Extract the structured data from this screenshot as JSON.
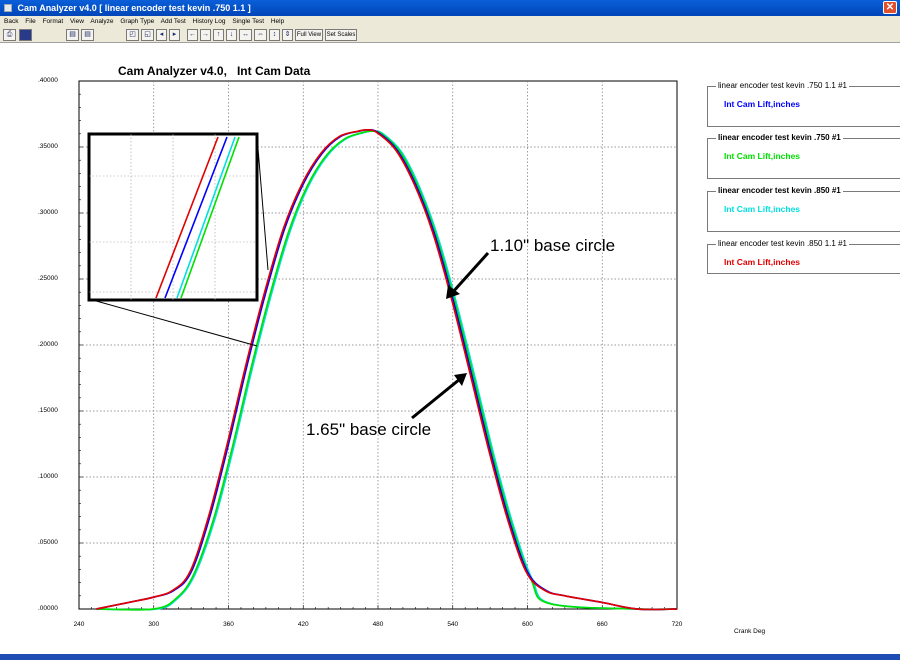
{
  "window": {
    "title": "Cam Analyzer v4.0  [ linear encoder test kevin .750 1.1 ]",
    "close_glyph": "✕"
  },
  "menu": [
    "Back",
    "File",
    "Format",
    "View",
    "Analyze",
    "Graph Type",
    "Add Test",
    "History Log",
    "Single Test",
    "Help"
  ],
  "toolbar": {
    "full_view_label": "Full View",
    "set_scales_label": "Set Scales",
    "icons": [
      "print-icon",
      "save-icon",
      "chart-a-icon",
      "chart-b-icon",
      "graph-icon",
      "graph2-icon",
      "zoom-out-icon",
      "zoom-in-icon",
      "left-arrow-icon",
      "right-arrow-icon",
      "up-arrow-icon",
      "down-arrow-icon",
      "expand-horizontal-icon",
      "compress-horizontal-icon",
      "expand-vertical-icon",
      "compress-vertical-icon"
    ]
  },
  "annotations": {
    "base_110": "1.10\" base circle",
    "base_165": "1.65\" base circle"
  },
  "legend": [
    {
      "title": "linear encoder test kevin .750 1.1 #1",
      "series": "Int Cam Lift,inches",
      "series_color": "#0000ff",
      "title_bold": false
    },
    {
      "title": "linear encoder test kevin .750 #1",
      "series": "Int Cam Lift,inches",
      "series_color": "#00e000",
      "title_bold": true
    },
    {
      "title": "linear encoder test kevin .850 #1",
      "series": "Int Cam Lift,inches",
      "series_color": "#00e0e0",
      "title_bold": true
    },
    {
      "title": "linear encoder test kevin .850 1.1 #1",
      "series": "Int Cam Lift,inches",
      "series_color": "#e00000",
      "title_bold": false
    }
  ],
  "chart_data": {
    "type": "line",
    "title": "Cam Analyzer v4.0,   Int Cam Data",
    "xlabel": "Crank Deg",
    "ylabel": "",
    "xlim": [
      240,
      720
    ],
    "ylim": [
      0,
      0.4
    ],
    "x_ticks": [
      "240",
      "300",
      "360",
      "420",
      "480",
      "540",
      "600",
      "660",
      "720"
    ],
    "y_ticks": [
      ".00000",
      ".05000",
      ".10000",
      ".15000",
      ".20000",
      ".25000",
      ".30000",
      ".35000",
      ".40000"
    ],
    "grid": true,
    "legend_position": "right",
    "series": [
      {
        "name": "linear encoder test kevin .750 1.1 #1",
        "color": "#0000ff",
        "x": [
          254,
          280,
          300,
          316,
          330,
          345,
          360,
          375,
          390,
          405,
          420,
          435,
          450,
          465,
          472,
          480,
          495,
          510,
          525,
          540,
          555,
          570,
          585,
          600,
          615,
          630,
          660,
          688,
          720
        ],
        "y": [
          0.0,
          0.005,
          0.009,
          0.014,
          0.028,
          0.07,
          0.125,
          0.185,
          0.24,
          0.288,
          0.322,
          0.345,
          0.358,
          0.362,
          0.363,
          0.361,
          0.348,
          0.322,
          0.285,
          0.235,
          0.178,
          0.12,
          0.068,
          0.028,
          0.014,
          0.01,
          0.005,
          0.0,
          0.0
        ]
      },
      {
        "name": "linear encoder test kevin .750 #1",
        "color": "#00e000",
        "x": [
          254,
          300,
          318,
          332,
          348,
          363,
          378,
          393,
          408,
          423,
          438,
          453,
          468,
          475,
          483,
          498,
          513,
          528,
          543,
          558,
          573,
          588,
          603,
          618,
          688,
          720
        ],
        "y": [
          0.0,
          0.0,
          0.008,
          0.026,
          0.068,
          0.122,
          0.182,
          0.237,
          0.285,
          0.32,
          0.343,
          0.356,
          0.361,
          0.362,
          0.36,
          0.346,
          0.318,
          0.279,
          0.228,
          0.171,
          0.113,
          0.062,
          0.022,
          0.004,
          0.0,
          0.0
        ]
      },
      {
        "name": "linear encoder test kevin .850 #1",
        "color": "#00e0e0",
        "x": [
          254,
          302,
          319,
          333,
          349,
          364,
          379,
          394,
          409,
          424,
          439,
          454,
          469,
          476,
          484,
          499,
          514,
          529,
          544,
          559,
          574,
          589,
          604,
          619,
          688,
          720
        ],
        "y": [
          0.0,
          0.0,
          0.008,
          0.026,
          0.068,
          0.122,
          0.182,
          0.237,
          0.285,
          0.32,
          0.343,
          0.356,
          0.361,
          0.362,
          0.36,
          0.346,
          0.318,
          0.279,
          0.228,
          0.171,
          0.113,
          0.062,
          0.022,
          0.004,
          0.0,
          0.0
        ]
      },
      {
        "name": "linear encoder test kevin .850 1.1 #1",
        "color": "#e00000",
        "x": [
          254,
          280,
          300,
          315,
          329,
          344,
          359,
          374,
          389,
          404,
          419,
          434,
          449,
          464,
          471,
          479,
          494,
          509,
          524,
          539,
          554,
          569,
          584,
          599,
          614,
          630,
          660,
          688,
          720
        ],
        "y": [
          0.0,
          0.005,
          0.009,
          0.014,
          0.028,
          0.07,
          0.125,
          0.185,
          0.24,
          0.288,
          0.322,
          0.345,
          0.358,
          0.362,
          0.363,
          0.361,
          0.348,
          0.322,
          0.285,
          0.235,
          0.178,
          0.12,
          0.068,
          0.028,
          0.014,
          0.01,
          0.005,
          0.0,
          0.0
        ]
      }
    ]
  }
}
